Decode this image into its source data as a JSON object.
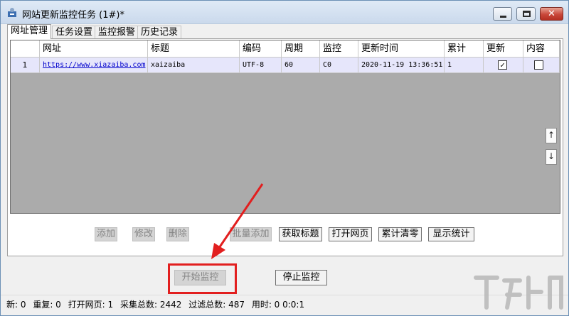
{
  "window": {
    "title": "网站更新监控任务 (1#)*"
  },
  "tabs": [
    {
      "label": "网址管理",
      "active": true
    },
    {
      "label": "任务设置",
      "active": false
    },
    {
      "label": "监控报警",
      "active": false
    },
    {
      "label": "历史记录",
      "active": false
    }
  ],
  "grid": {
    "columns": [
      "",
      "网址",
      "标题",
      "编码",
      "周期",
      "监控",
      "更新时间",
      "累计",
      "更新",
      "内容"
    ],
    "rows": [
      {
        "index": "1",
        "url": "https://www.xiazaiba.com",
        "title": "xaizaiba",
        "encoding": "UTF-8",
        "period": "60",
        "monitor": "C0",
        "update_time": "2020-11-19 13:36:51",
        "total": "1",
        "updated_checked": true,
        "content_checked": false
      }
    ]
  },
  "actions": {
    "add": "添加",
    "edit": "修改",
    "delete": "删除",
    "batch_add": "批量添加",
    "get_title": "获取标题",
    "open_page": "打开网页",
    "clear_total": "累计清零",
    "show_stats": "显示统计"
  },
  "monitor": {
    "start": "开始监控",
    "stop": "停止监控"
  },
  "status": {
    "new": "新: 0",
    "repeat": "重复: 0",
    "opened": "打开网页: 1",
    "collected": "采集总数: 2442",
    "filtered": "过滤总数: 487",
    "elapsed": "用时: 0 0:0:1"
  },
  "icons": {
    "scroll_up": "↑",
    "scroll_down": "↓",
    "check": "✓",
    "close": "✕"
  },
  "colors": {
    "annotation": "#e21f1f",
    "selected_row": "#e6e6fb",
    "grid_background": "#ababab"
  }
}
